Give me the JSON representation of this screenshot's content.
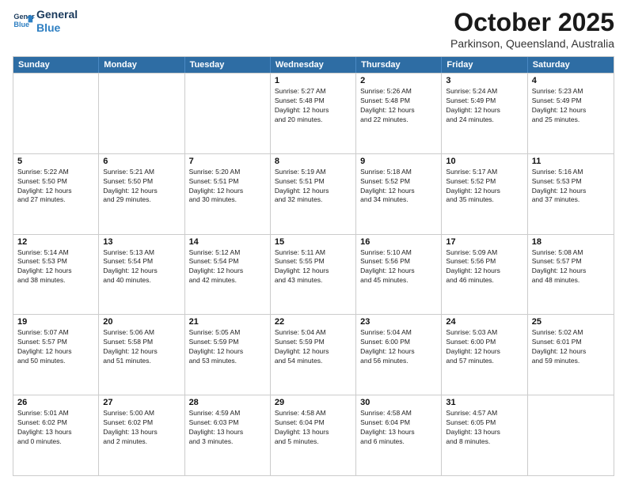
{
  "logo": {
    "line1": "General",
    "line2": "Blue"
  },
  "header": {
    "month": "October 2025",
    "location": "Parkinson, Queensland, Australia"
  },
  "days": [
    "Sunday",
    "Monday",
    "Tuesday",
    "Wednesday",
    "Thursday",
    "Friday",
    "Saturday"
  ],
  "weeks": [
    [
      {
        "day": "",
        "info": ""
      },
      {
        "day": "",
        "info": ""
      },
      {
        "day": "",
        "info": ""
      },
      {
        "day": "1",
        "info": "Sunrise: 5:27 AM\nSunset: 5:48 PM\nDaylight: 12 hours\nand 20 minutes."
      },
      {
        "day": "2",
        "info": "Sunrise: 5:26 AM\nSunset: 5:48 PM\nDaylight: 12 hours\nand 22 minutes."
      },
      {
        "day": "3",
        "info": "Sunrise: 5:24 AM\nSunset: 5:49 PM\nDaylight: 12 hours\nand 24 minutes."
      },
      {
        "day": "4",
        "info": "Sunrise: 5:23 AM\nSunset: 5:49 PM\nDaylight: 12 hours\nand 25 minutes."
      }
    ],
    [
      {
        "day": "5",
        "info": "Sunrise: 5:22 AM\nSunset: 5:50 PM\nDaylight: 12 hours\nand 27 minutes."
      },
      {
        "day": "6",
        "info": "Sunrise: 5:21 AM\nSunset: 5:50 PM\nDaylight: 12 hours\nand 29 minutes."
      },
      {
        "day": "7",
        "info": "Sunrise: 5:20 AM\nSunset: 5:51 PM\nDaylight: 12 hours\nand 30 minutes."
      },
      {
        "day": "8",
        "info": "Sunrise: 5:19 AM\nSunset: 5:51 PM\nDaylight: 12 hours\nand 32 minutes."
      },
      {
        "day": "9",
        "info": "Sunrise: 5:18 AM\nSunset: 5:52 PM\nDaylight: 12 hours\nand 34 minutes."
      },
      {
        "day": "10",
        "info": "Sunrise: 5:17 AM\nSunset: 5:52 PM\nDaylight: 12 hours\nand 35 minutes."
      },
      {
        "day": "11",
        "info": "Sunrise: 5:16 AM\nSunset: 5:53 PM\nDaylight: 12 hours\nand 37 minutes."
      }
    ],
    [
      {
        "day": "12",
        "info": "Sunrise: 5:14 AM\nSunset: 5:53 PM\nDaylight: 12 hours\nand 38 minutes."
      },
      {
        "day": "13",
        "info": "Sunrise: 5:13 AM\nSunset: 5:54 PM\nDaylight: 12 hours\nand 40 minutes."
      },
      {
        "day": "14",
        "info": "Sunrise: 5:12 AM\nSunset: 5:54 PM\nDaylight: 12 hours\nand 42 minutes."
      },
      {
        "day": "15",
        "info": "Sunrise: 5:11 AM\nSunset: 5:55 PM\nDaylight: 12 hours\nand 43 minutes."
      },
      {
        "day": "16",
        "info": "Sunrise: 5:10 AM\nSunset: 5:56 PM\nDaylight: 12 hours\nand 45 minutes."
      },
      {
        "day": "17",
        "info": "Sunrise: 5:09 AM\nSunset: 5:56 PM\nDaylight: 12 hours\nand 46 minutes."
      },
      {
        "day": "18",
        "info": "Sunrise: 5:08 AM\nSunset: 5:57 PM\nDaylight: 12 hours\nand 48 minutes."
      }
    ],
    [
      {
        "day": "19",
        "info": "Sunrise: 5:07 AM\nSunset: 5:57 PM\nDaylight: 12 hours\nand 50 minutes."
      },
      {
        "day": "20",
        "info": "Sunrise: 5:06 AM\nSunset: 5:58 PM\nDaylight: 12 hours\nand 51 minutes."
      },
      {
        "day": "21",
        "info": "Sunrise: 5:05 AM\nSunset: 5:59 PM\nDaylight: 12 hours\nand 53 minutes."
      },
      {
        "day": "22",
        "info": "Sunrise: 5:04 AM\nSunset: 5:59 PM\nDaylight: 12 hours\nand 54 minutes."
      },
      {
        "day": "23",
        "info": "Sunrise: 5:04 AM\nSunset: 6:00 PM\nDaylight: 12 hours\nand 56 minutes."
      },
      {
        "day": "24",
        "info": "Sunrise: 5:03 AM\nSunset: 6:00 PM\nDaylight: 12 hours\nand 57 minutes."
      },
      {
        "day": "25",
        "info": "Sunrise: 5:02 AM\nSunset: 6:01 PM\nDaylight: 12 hours\nand 59 minutes."
      }
    ],
    [
      {
        "day": "26",
        "info": "Sunrise: 5:01 AM\nSunset: 6:02 PM\nDaylight: 13 hours\nand 0 minutes."
      },
      {
        "day": "27",
        "info": "Sunrise: 5:00 AM\nSunset: 6:02 PM\nDaylight: 13 hours\nand 2 minutes."
      },
      {
        "day": "28",
        "info": "Sunrise: 4:59 AM\nSunset: 6:03 PM\nDaylight: 13 hours\nand 3 minutes."
      },
      {
        "day": "29",
        "info": "Sunrise: 4:58 AM\nSunset: 6:04 PM\nDaylight: 13 hours\nand 5 minutes."
      },
      {
        "day": "30",
        "info": "Sunrise: 4:58 AM\nSunset: 6:04 PM\nDaylight: 13 hours\nand 6 minutes."
      },
      {
        "day": "31",
        "info": "Sunrise: 4:57 AM\nSunset: 6:05 PM\nDaylight: 13 hours\nand 8 minutes."
      },
      {
        "day": "",
        "info": ""
      }
    ]
  ]
}
